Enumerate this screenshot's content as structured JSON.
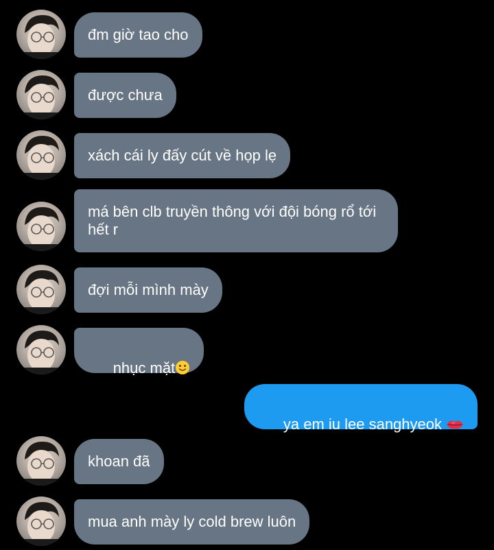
{
  "conversation": {
    "messages": [
      {
        "sender": "them",
        "text": "đm giờ tao cho"
      },
      {
        "sender": "them",
        "text": "được chưa"
      },
      {
        "sender": "them",
        "text": "xách cái ly đấy cút về họp lẹ"
      },
      {
        "sender": "them",
        "text": "má bên clb truyền thông với đội bóng rổ tới hết r"
      },
      {
        "sender": "them",
        "text": "đợi mỗi mình mày"
      },
      {
        "sender": "them",
        "text": "nhục mặt",
        "emoji": "slightly-smiling-face-icon"
      },
      {
        "sender": "me",
        "text": "ya em iu lee sanghyeok",
        "emoji": "lips-icon"
      },
      {
        "sender": "them",
        "text": "khoan đã"
      },
      {
        "sender": "them",
        "text": "mua anh mày ly cold brew luôn"
      }
    ]
  },
  "colors": {
    "background": "#000000",
    "incoming_bubble": "#677584",
    "outgoing_bubble": "#1d9bf0",
    "text": "#ffffff"
  }
}
